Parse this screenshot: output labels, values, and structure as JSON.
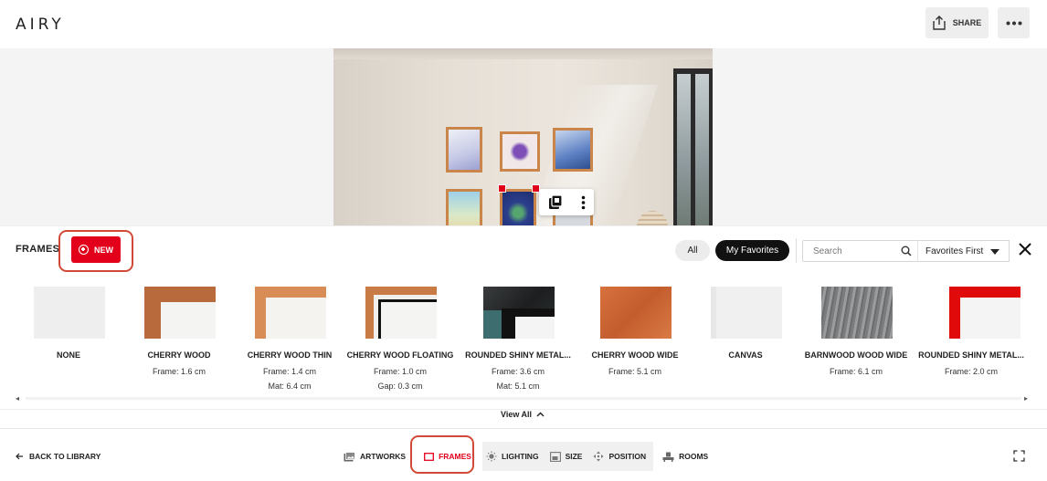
{
  "header": {
    "logo": "AIRY",
    "share_label": "SHARE"
  },
  "frames_panel": {
    "title": "FRAMES",
    "new_label": "NEW",
    "filters": {
      "all": "All",
      "favorites": "My Favorites",
      "active": "favorites"
    },
    "search": {
      "placeholder": "Search",
      "value": ""
    },
    "sort": {
      "selected": "Favorites First"
    },
    "items": [
      {
        "name": "NONE",
        "spec1": "",
        "spec2": ""
      },
      {
        "name": "CHERRY WOOD",
        "spec1": "Frame: 1.6 cm",
        "spec2": ""
      },
      {
        "name": "CHERRY WOOD THIN",
        "spec1": "Frame: 1.4 cm",
        "spec2": "Mat: 6.4 cm"
      },
      {
        "name": "CHERRY WOOD FLOATING",
        "spec1": "Frame: 1.0 cm",
        "spec2": "Gap: 0.3 cm"
      },
      {
        "name": "ROUNDED SHINY METAL...",
        "spec1": "Frame: 3.6 cm",
        "spec2": "Mat: 5.1 cm"
      },
      {
        "name": "CHERRY WOOD WIDE",
        "spec1": "Frame: 5.1 cm",
        "spec2": ""
      },
      {
        "name": "CANVAS",
        "spec1": "",
        "spec2": ""
      },
      {
        "name": "BARNWOOD WOOD WIDE",
        "spec1": "Frame: 6.1 cm",
        "spec2": ""
      },
      {
        "name": "ROUNDED SHINY METAL...",
        "spec1": "Frame: 2.0 cm",
        "spec2": ""
      }
    ],
    "view_all_label": "View All"
  },
  "bottom_bar": {
    "back_label": "BACK TO LIBRARY",
    "tools": {
      "artworks": "ARTWORKS",
      "frames": "FRAMES",
      "lighting": "LIGHTING",
      "size": "SIZE",
      "position": "POSITION",
      "rooms": "ROOMS"
    },
    "active_tool": "frames"
  },
  "colors": {
    "accent_red": "#e3001b",
    "highlight_outline": "#d14a37",
    "cherry_wood": "#c9854a"
  },
  "icons": [
    "share-icon",
    "more-icon",
    "plus-circle-icon",
    "search-icon",
    "chevron-down-icon",
    "close-icon",
    "chevron-up-icon",
    "arrow-left-icon",
    "artworks-icon",
    "frames-icon",
    "lighting-icon",
    "size-icon",
    "position-icon",
    "rooms-icon",
    "fullscreen-icon",
    "copy-stack-icon",
    "vertical-dots-icon"
  ]
}
